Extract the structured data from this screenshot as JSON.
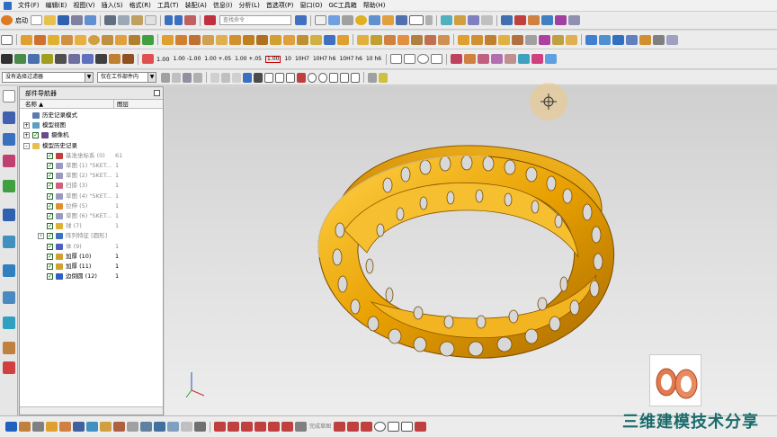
{
  "menus": [
    "文件(F)",
    "编辑(E)",
    "视图(V)",
    "插入(S)",
    "格式(R)",
    "工具(T)",
    "装配(A)",
    "信息(I)",
    "分析(L)",
    "首选项(P)",
    "窗口(O)",
    "GC工具箱",
    "帮助(H)"
  ],
  "toolbar1": {
    "start_label": "启动",
    "search_placeholder": "查找命令"
  },
  "toolbar3_labels": [
    "1.00",
    "1.00\n-1.00",
    "1.00\n+.05",
    "1.00\n+.05",
    "1.00",
    "10",
    "10H7",
    "10H7\nh6",
    "10H7\nh6",
    "10\nh6"
  ],
  "filter": {
    "selection_filter": "没有选择过滤器",
    "assembly_scope": "仅在工作部件内"
  },
  "navigator": {
    "title": "部件导航器",
    "col_name": "名称",
    "col_layer": "图层",
    "rows": [
      {
        "label": "历史记录模式",
        "layer": "",
        "indent": 0,
        "exp": "",
        "chk": false,
        "icon": "history-clock-icon",
        "grey": false
      },
      {
        "label": "模型视图",
        "layer": "",
        "indent": 0,
        "exp": "+",
        "chk": false,
        "icon": "model-views-icon",
        "grey": false
      },
      {
        "label": "摄像机",
        "layer": "",
        "indent": 0,
        "exp": "+",
        "chk": true,
        "icon": "camera-icon",
        "grey": false
      },
      {
        "label": "模型历史记录",
        "layer": "",
        "indent": 0,
        "exp": "-",
        "chk": false,
        "icon": "folder-icon",
        "grey": false
      },
      {
        "label": "基准坐标系 (0)",
        "layer": "61",
        "indent": 1,
        "exp": "",
        "chk": true,
        "icon": "datum-csys-icon",
        "grey": true
      },
      {
        "label": "草图 (1) \"SKET...",
        "layer": "1",
        "indent": 1,
        "exp": "",
        "chk": true,
        "icon": "sketch-icon",
        "grey": true
      },
      {
        "label": "草图 (2) \"SKET...",
        "layer": "1",
        "indent": 1,
        "exp": "",
        "chk": true,
        "icon": "sketch-icon",
        "grey": true
      },
      {
        "label": "扫掠 (3)",
        "layer": "1",
        "indent": 1,
        "exp": "",
        "chk": true,
        "icon": "sweep-icon",
        "grey": true
      },
      {
        "label": "草图 (4) \"SKET...",
        "layer": "1",
        "indent": 1,
        "exp": "",
        "chk": true,
        "icon": "sketch-icon",
        "grey": true
      },
      {
        "label": "拉伸 (5)",
        "layer": "1",
        "indent": 1,
        "exp": "",
        "chk": true,
        "icon": "extrude-icon",
        "grey": true
      },
      {
        "label": "草图 (6) \"SKET...",
        "layer": "1",
        "indent": 1,
        "exp": "",
        "chk": true,
        "icon": "sketch-icon",
        "grey": true
      },
      {
        "label": "球 (7)",
        "layer": "1",
        "indent": 1,
        "exp": "",
        "chk": true,
        "icon": "sphere-icon",
        "grey": true
      },
      {
        "label": "阵列特征 [圆形]",
        "layer": "",
        "indent": 1,
        "exp": "+",
        "chk": true,
        "icon": "pattern-icon",
        "grey": true
      },
      {
        "label": "体 (9)",
        "layer": "1",
        "indent": 1,
        "exp": "",
        "chk": true,
        "icon": "body-icon",
        "grey": true
      },
      {
        "label": "加厚 (10)",
        "layer": "1",
        "indent": 1,
        "exp": "",
        "chk": true,
        "icon": "thicken-icon",
        "grey": false
      },
      {
        "label": "加厚 (11)",
        "layer": "1",
        "indent": 1,
        "exp": "",
        "chk": true,
        "icon": "thicken-icon",
        "grey": false
      },
      {
        "label": "边倒圆 (12)",
        "layer": "1",
        "indent": 1,
        "exp": "",
        "chk": true,
        "icon": "edge-blend-icon",
        "grey": false
      }
    ]
  },
  "bottom": {
    "sketch_label": "完成草图"
  },
  "watermark": "三维建模技术分享",
  "colors": {
    "model": "#e8a000",
    "model_dark": "#a86a00",
    "accent": "#1a6b6b"
  }
}
